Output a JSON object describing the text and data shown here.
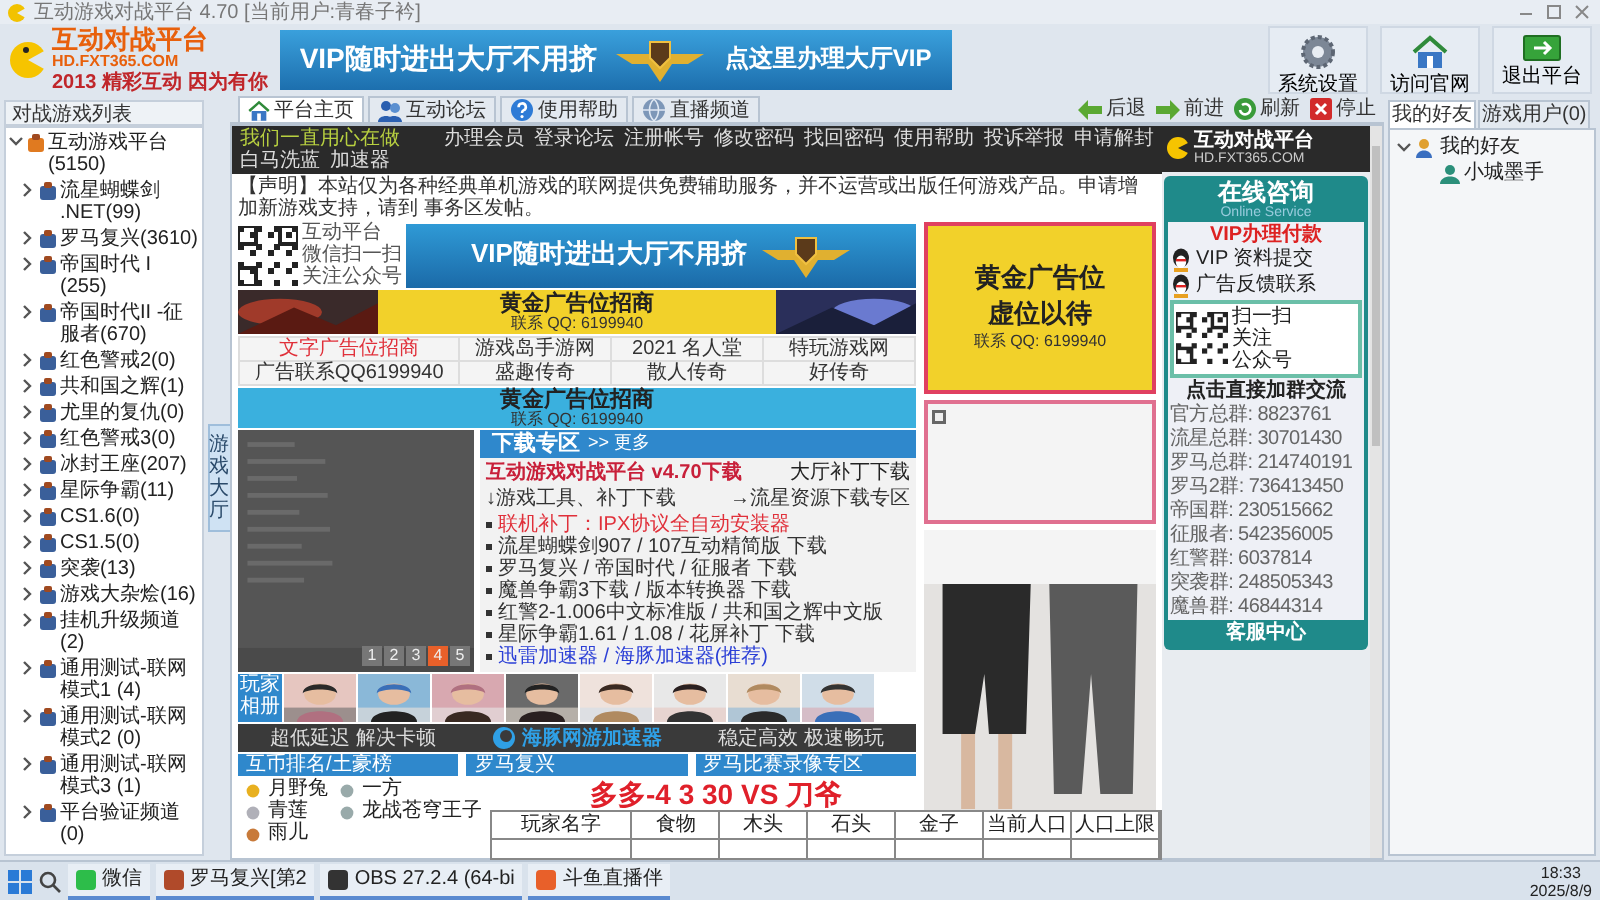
{
  "window": {
    "title": "互动游戏对战平台 4.70 [当前用户:青春子衿]"
  },
  "header": {
    "logo": {
      "name": "互动对战平台",
      "domain": "HD.FXT365.COM",
      "slogan": "2013 精彩互动 因为有你"
    },
    "banner": {
      "left": "VIP随时进出大厅不用挤",
      "right": "点这里办理大厅VIP"
    },
    "buttons": [
      {
        "label": "系统设置",
        "kind": "gear"
      },
      {
        "label": "访问官网",
        "kind": "house"
      },
      {
        "label": "退出平台",
        "kind": "exit"
      }
    ]
  },
  "game_list": {
    "title": "对战游戏列表",
    "tree": [
      {
        "label": "互动游戏平台(5150)",
        "expanded": true,
        "children": [
          {
            "label": "流星蝴蝶剑 .NET(99)",
            "expanded": false
          },
          {
            "label": "罗马复兴(3610)",
            "expanded": false
          },
          {
            "label": "帝国时代 I (255)",
            "expanded": false
          },
          {
            "label": "帝国时代II -征服者(670)",
            "expanded": false
          },
          {
            "label": "红色警戒2(0)",
            "expanded": false
          },
          {
            "label": "共和国之辉(1)",
            "expanded": false
          },
          {
            "label": "尤里的复仇(0)",
            "expanded": false
          },
          {
            "label": "红色警戒3(0)",
            "expanded": false
          },
          {
            "label": "冰封王座(207)",
            "expanded": false
          },
          {
            "label": "星际争霸(11)",
            "expanded": false
          },
          {
            "label": "CS1.6(0)",
            "expanded": false
          },
          {
            "label": "CS1.5(0)",
            "expanded": false
          },
          {
            "label": "突袭(13)",
            "expanded": false
          },
          {
            "label": "游戏大杂烩(16)",
            "expanded": false
          },
          {
            "label": "挂机升级频道(2)",
            "expanded": false
          },
          {
            "label": "通用测试-联网模式1 (4)",
            "expanded": false
          },
          {
            "label": "通用测试-联网模式2 (0)",
            "expanded": false
          },
          {
            "label": "通用测试-联网模式3 (1)",
            "expanded": false
          },
          {
            "label": "平台验证频道(0)",
            "expanded": false
          }
        ]
      }
    ]
  },
  "side_tab": "游戏大厅",
  "browser": {
    "tabs": [
      {
        "label": "平台主页",
        "selected": true,
        "kind": "house"
      },
      {
        "label": "互动论坛",
        "selected": false,
        "kind": "people"
      },
      {
        "label": "使用帮助",
        "selected": false,
        "kind": "help"
      },
      {
        "label": "直播频道",
        "selected": false,
        "kind": "globe"
      }
    ],
    "nav_buttons": [
      {
        "label": "后退",
        "kind": "back"
      },
      {
        "label": "前进",
        "kind": "forward"
      },
      {
        "label": "刷新",
        "kind": "refresh"
      },
      {
        "label": "停止",
        "kind": "stop"
      }
    ]
  },
  "page": {
    "slogan": "我们一直用心在做",
    "nav": [
      "办理会员",
      "登录论坛",
      "注册帐号",
      "修改密码",
      "找回密码",
      "使用帮助",
      "投诉举报",
      "申请解封",
      "白马洗蓝",
      "加速器"
    ],
    "notice": "【声明】本站仅为各种经典单机游戏的联网提供免费辅助服务，并不运营或出版任何游戏产品。申请增加新游戏支持，请到 事务区发帖。",
    "qr_text": [
      "互动平台",
      "微信扫一扫",
      "关注公众号"
    ],
    "vip_banner": "VIP随时进出大厅不用挤",
    "gold_ad": {
      "title": "黄金广告位招商",
      "contact": "联系 QQ: 6199940"
    },
    "links": [
      {
        "label": "文字广告位招商",
        "color": "#e0303a"
      },
      {
        "label": "游戏岛手游网",
        "color": "#333333"
      },
      {
        "label": "2021 名人堂",
        "color": "#333333"
      },
      {
        "label": "特玩游戏网",
        "color": "#333333"
      },
      {
        "label": "广告联系QQ6199940",
        "color": "#333333"
      },
      {
        "label": "盛趣传奇",
        "color": "#333333"
      },
      {
        "label": "散人传奇",
        "color": "#333333"
      },
      {
        "label": "好传奇",
        "color": "#333333"
      }
    ],
    "blue_ad": {
      "title": "黄金广告位招商",
      "contact": "联系 QQ: 6199940"
    },
    "carousel_pages": [
      {
        "label": "1",
        "selected": false
      },
      {
        "label": "2",
        "selected": false
      },
      {
        "label": "3",
        "selected": false
      },
      {
        "label": "4",
        "selected": true
      },
      {
        "label": "5",
        "selected": false
      }
    ],
    "downloads": {
      "title": "下载专区",
      "more": ">> 更多",
      "headline": "互动游戏对战平台 v4.70下载",
      "patch": "大厅补丁下载",
      "tools": "↓游戏工具、补丁下载",
      "resources": "→流星资源下载专区",
      "items": [
        {
          "label": "联机补丁：IPX协议全自动安装器",
          "color": "#e0303a"
        },
        {
          "label": "流星蝴蝶剑907 / 107互动精简版 下载",
          "color": "#333333"
        },
        {
          "label": "罗马复兴 / 帝国时代 / 征服者 下载",
          "color": "#333333"
        },
        {
          "label": "魔兽争霸3下载 / 版本转换器 下载",
          "color": "#333333"
        },
        {
          "label": "红警2-1.006中文标准版 / 共和国之辉中文版",
          "color": "#333333"
        },
        {
          "label": "星际争霸1.61 / 1.08 / 花屏补丁 下载",
          "color": "#333333"
        },
        {
          "label": "迅雷加速器 / 海豚加速器(推荐)",
          "color": "#2b3fd6"
        }
      ]
    },
    "album_label": "玩家相册",
    "photos": [
      {
        "kind": "picture"
      },
      {
        "kind": "picture"
      },
      {
        "kind": "picture"
      },
      {
        "kind": "picture"
      },
      {
        "kind": "picture"
      },
      {
        "kind": "picture"
      },
      {
        "kind": "picture"
      },
      {
        "kind": "picture"
      }
    ],
    "accelerator": {
      "left": "超低延迟 解决卡顿",
      "name": "海豚网游加速器",
      "right": "稳定高效 极速畅玩"
    },
    "sections": [
      "互币排名/土豪榜",
      "罗马复兴",
      "罗马比赛录像专区"
    ],
    "ranking": [
      "月野兔",
      "青莲",
      "雨儿",
      "一方",
      "龙战苍穹王子"
    ],
    "side_ad": {
      "title": "黄金广告位",
      "subtitle": "虚位以待",
      "contact": "联系 QQ: 6199940"
    }
  },
  "consult": {
    "logo": "互动对战平台",
    "domain": "HD.FXT365.COM",
    "title": "在线咨询",
    "subtitle": "Online Service",
    "vip": "VIP办理付款",
    "contacts": [
      "VIP 资料提交",
      "广告反馈联系"
    ],
    "qr_text": [
      "扫一扫",
      "关注",
      "公众号"
    ],
    "join": "点击直接加群交流",
    "groups": [
      "官方总群: 8823761",
      "流星总群: 30701430",
      "罗马总群: 214740191",
      "罗马2群: 736413450",
      "帝国群: 230515662",
      "征服者: 542356005",
      "红警群: 6037814",
      "突袭群: 248505343",
      "魔兽群: 46844314"
    ],
    "footer": "客服中心"
  },
  "friends": {
    "tabs": [
      {
        "label": "我的好友",
        "selected": true
      },
      {
        "label": "游戏用户(0)",
        "selected": false
      }
    ],
    "tree": [
      {
        "label": "我的好友",
        "expanded": true,
        "children": [
          {
            "label": "小城墨手"
          }
        ]
      }
    ]
  },
  "overlay_caption": "多多-4 3 30 VS 刀爷",
  "score_table": {
    "columns": [
      "玩家名字",
      "食物",
      "木头",
      "石头",
      "金子",
      "当前人口",
      "人口上限"
    ]
  },
  "taskbar": {
    "apps": [
      {
        "label": "微信",
        "kind": "chat"
      },
      {
        "label": "罗马复兴[第2",
        "kind": "game"
      },
      {
        "label": "OBS 27.2.4 (64-bi",
        "kind": "record"
      },
      {
        "label": "斗鱼直播伴",
        "kind": "live"
      }
    ],
    "time": "18:33",
    "date": "2025/8/9"
  }
}
